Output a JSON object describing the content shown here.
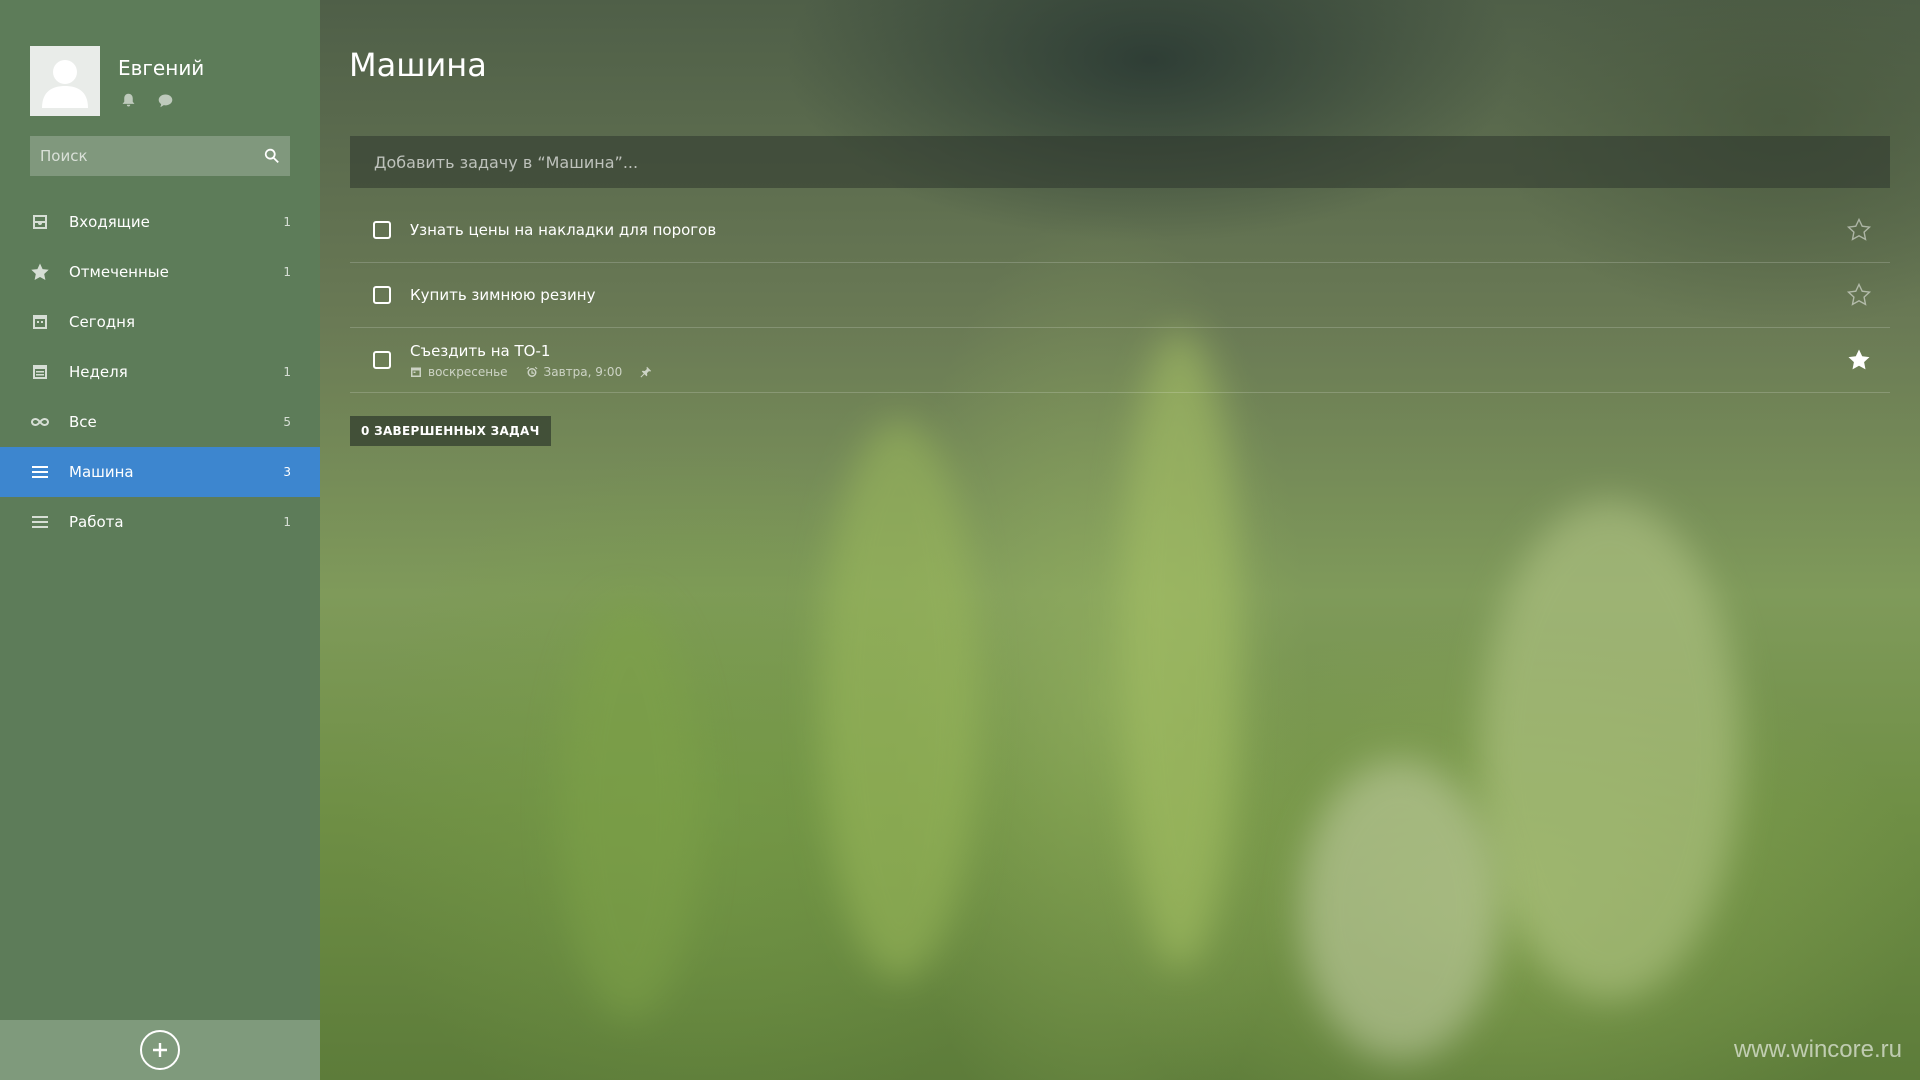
{
  "user": {
    "name": "Евгений",
    "notifications_icon": "bell-icon",
    "conversations_icon": "chat-bubble-icon"
  },
  "search": {
    "placeholder": "Поиск",
    "icon": "search-icon"
  },
  "sidebar": {
    "items": [
      {
        "label": "Входящие",
        "count": "1",
        "icon": "inbox-icon"
      },
      {
        "label": "Отмеченные",
        "count": "1",
        "icon": "star-icon"
      },
      {
        "label": "Сегодня",
        "count": "",
        "icon": "calendar-today-icon"
      },
      {
        "label": "Неделя",
        "count": "1",
        "icon": "calendar-week-icon"
      },
      {
        "label": "Все",
        "count": "5",
        "icon": "infinity-icon"
      },
      {
        "label": "Машина",
        "count": "3",
        "icon": "list-icon",
        "active": true
      },
      {
        "label": "Работа",
        "count": "1",
        "icon": "list-icon"
      }
    ],
    "add_list_icon": "plus-circle-icon"
  },
  "main": {
    "title": "Машина",
    "add_task_placeholder": "Добавить задачу в “Машина”...",
    "tasks": [
      {
        "title": "Узнать цены на накладки для порогов",
        "starred": false
      },
      {
        "title": "Купить зимнюю резину",
        "starred": false
      },
      {
        "title": "Съездить на ТО-1",
        "due": "воскресенье",
        "reminder": "Завтра, 9:00",
        "starred": true
      }
    ],
    "completed_label": "0 ЗАВЕРШЕННЫХ ЗАДАЧ"
  },
  "watermark": "www.wincore.ru",
  "colors": {
    "sidebar_bg": "#5d7c59",
    "active_item": "#3d86cf",
    "footer_bg": "#7f9a7c"
  }
}
